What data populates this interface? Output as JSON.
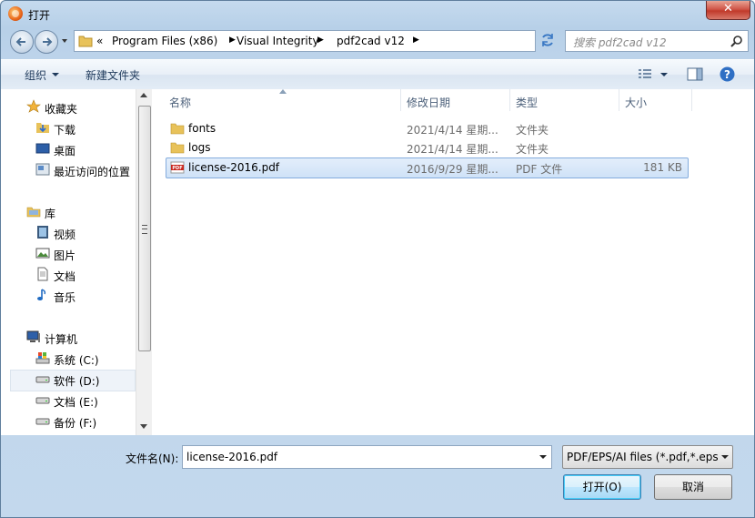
{
  "window": {
    "title": "打开",
    "close": "✕"
  },
  "address": {
    "overflow": "«",
    "crumbs": [
      "Program Files (x86)",
      "Visual Integrity",
      "pdf2cad v12"
    ]
  },
  "search": {
    "placeholder": "搜索 pdf2cad v12"
  },
  "toolbar": {
    "organize": "组织",
    "new_folder": "新建文件夹"
  },
  "nav": {
    "favorites": {
      "label": "收藏夹",
      "items": [
        "下载",
        "桌面",
        "最近访问的位置"
      ]
    },
    "libraries": {
      "label": "库",
      "items": [
        "视频",
        "图片",
        "文档",
        "音乐"
      ]
    },
    "computer": {
      "label": "计算机",
      "items": [
        "系统 (C:)",
        "软件 (D:)",
        "文档 (E:)",
        "备份 (F:)"
      ]
    }
  },
  "columns": {
    "name": "名称",
    "date": "修改日期",
    "type": "类型",
    "size": "大小"
  },
  "files": [
    {
      "name": "fonts",
      "date": "2021/4/14 星期...",
      "type": "文件夹",
      "size": "",
      "kind": "folder"
    },
    {
      "name": "logs",
      "date": "2021/4/14 星期...",
      "type": "文件夹",
      "size": "",
      "kind": "folder"
    },
    {
      "name": "license-2016.pdf",
      "date": "2016/9/29 星期...",
      "type": "PDF 文件",
      "size": "181 KB",
      "kind": "pdf"
    }
  ],
  "bottom": {
    "filename_label": "文件名(N):",
    "filename_value": "license-2016.pdf",
    "filetype_value": "PDF/EPS/AI files (*.pdf,*.eps,",
    "open_label": "打开(O)",
    "cancel_label": "取消"
  },
  "colors": {
    "accent": "#3c7fb1",
    "selection": "#cfe2f7",
    "close": "#c13a2a"
  }
}
